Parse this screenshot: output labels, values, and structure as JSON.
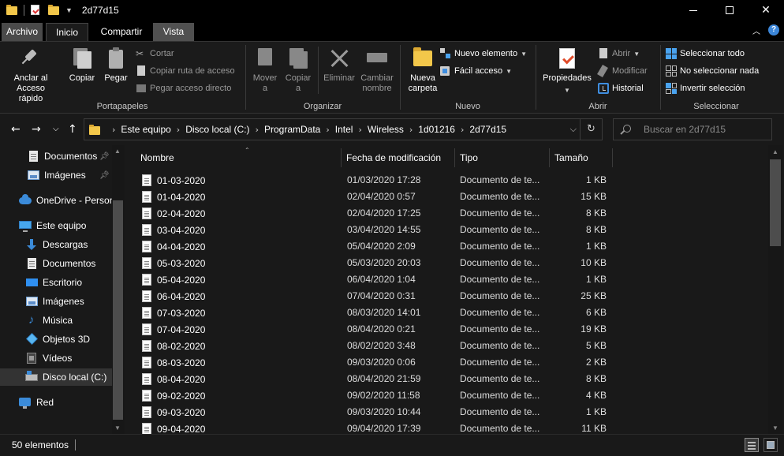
{
  "window": {
    "title": "2d77d15"
  },
  "ribbon_tabs": [
    {
      "label": "Archivo"
    },
    {
      "label": "Inicio"
    },
    {
      "label": "Compartir"
    },
    {
      "label": "Vista"
    }
  ],
  "ribbon": {
    "portapapeles": {
      "label": "Portapapeles",
      "pin": "Anclar al\nAcceso rápido",
      "copy": "Copiar",
      "paste": "Pegar",
      "cut": "Cortar",
      "copy_path": "Copiar ruta de acceso",
      "paste_shortcut": "Pegar acceso directo"
    },
    "organizar": {
      "label": "Organizar",
      "move": "Mover\na",
      "copy_to": "Copiar\na",
      "delete": "Eliminar",
      "rename": "Cambiar\nnombre"
    },
    "nuevo": {
      "label": "Nuevo",
      "new_folder": "Nueva\ncarpeta",
      "new_item": "Nuevo elemento",
      "easy_access": "Fácil acceso"
    },
    "abrir": {
      "label": "Abrir",
      "properties": "Propiedades",
      "open": "Abrir",
      "edit": "Modificar",
      "history": "Historial"
    },
    "seleccionar": {
      "label": "Seleccionar",
      "select_all": "Seleccionar todo",
      "select_none": "No seleccionar nada",
      "invert": "Invertir selección"
    }
  },
  "address": {
    "crumbs": [
      "Este equipo",
      "Disco local (C:)",
      "ProgramData",
      "Intel",
      "Wireless",
      "1d01216",
      "2d77d15"
    ],
    "search_placeholder": "Buscar en 2d77d15"
  },
  "nav_pane": {
    "items": [
      {
        "label": "Documentos",
        "icon": "documents-icon",
        "pinned": true
      },
      {
        "label": "Imágenes",
        "icon": "pictures-icon",
        "pinned": true
      },
      {
        "label": "OneDrive - Person",
        "icon": "onedrive-icon"
      },
      {
        "label": "Este equipo",
        "icon": "this-pc-icon"
      },
      {
        "label": "Descargas",
        "icon": "downloads-icon"
      },
      {
        "label": "Documentos",
        "icon": "documents-icon"
      },
      {
        "label": "Escritorio",
        "icon": "desktop-icon"
      },
      {
        "label": "Imágenes",
        "icon": "pictures-icon"
      },
      {
        "label": "Música",
        "icon": "music-icon"
      },
      {
        "label": "Objetos 3D",
        "icon": "3d-objects-icon"
      },
      {
        "label": "Vídeos",
        "icon": "videos-icon"
      },
      {
        "label": "Disco local (C:)",
        "icon": "drive-icon",
        "selected": true
      },
      {
        "label": "Red",
        "icon": "network-icon"
      }
    ]
  },
  "file_list": {
    "columns": {
      "name": "Nombre",
      "date": "Fecha de modificación",
      "type": "Tipo",
      "size": "Tamaño"
    },
    "rows": [
      {
        "name": "01-03-2020",
        "date": "01/03/2020 17:28",
        "type": "Documento de te...",
        "size": "1 KB"
      },
      {
        "name": "01-04-2020",
        "date": "02/04/2020 0:57",
        "type": "Documento de te...",
        "size": "15 KB"
      },
      {
        "name": "02-04-2020",
        "date": "02/04/2020 17:25",
        "type": "Documento de te...",
        "size": "8 KB"
      },
      {
        "name": "03-04-2020",
        "date": "03/04/2020 14:55",
        "type": "Documento de te...",
        "size": "8 KB"
      },
      {
        "name": "04-04-2020",
        "date": "05/04/2020 2:09",
        "type": "Documento de te...",
        "size": "1 KB"
      },
      {
        "name": "05-03-2020",
        "date": "05/03/2020 20:03",
        "type": "Documento de te...",
        "size": "10 KB"
      },
      {
        "name": "05-04-2020",
        "date": "06/04/2020 1:04",
        "type": "Documento de te...",
        "size": "1 KB"
      },
      {
        "name": "06-04-2020",
        "date": "07/04/2020 0:31",
        "type": "Documento de te...",
        "size": "25 KB"
      },
      {
        "name": "07-03-2020",
        "date": "08/03/2020 14:01",
        "type": "Documento de te...",
        "size": "6 KB"
      },
      {
        "name": "07-04-2020",
        "date": "08/04/2020 0:21",
        "type": "Documento de te...",
        "size": "19 KB"
      },
      {
        "name": "08-02-2020",
        "date": "08/02/2020 3:48",
        "type": "Documento de te...",
        "size": "5 KB"
      },
      {
        "name": "08-03-2020",
        "date": "09/03/2020 0:06",
        "type": "Documento de te...",
        "size": "2 KB"
      },
      {
        "name": "08-04-2020",
        "date": "08/04/2020 21:59",
        "type": "Documento de te...",
        "size": "8 KB"
      },
      {
        "name": "09-02-2020",
        "date": "09/02/2020 11:58",
        "type": "Documento de te...",
        "size": "4 KB"
      },
      {
        "name": "09-03-2020",
        "date": "09/03/2020 10:44",
        "type": "Documento de te...",
        "size": "1 KB"
      },
      {
        "name": "09-04-2020",
        "date": "09/04/2020 17:39",
        "type": "Documento de te...",
        "size": "11 KB"
      }
    ]
  },
  "status": {
    "count": "50 elementos"
  }
}
